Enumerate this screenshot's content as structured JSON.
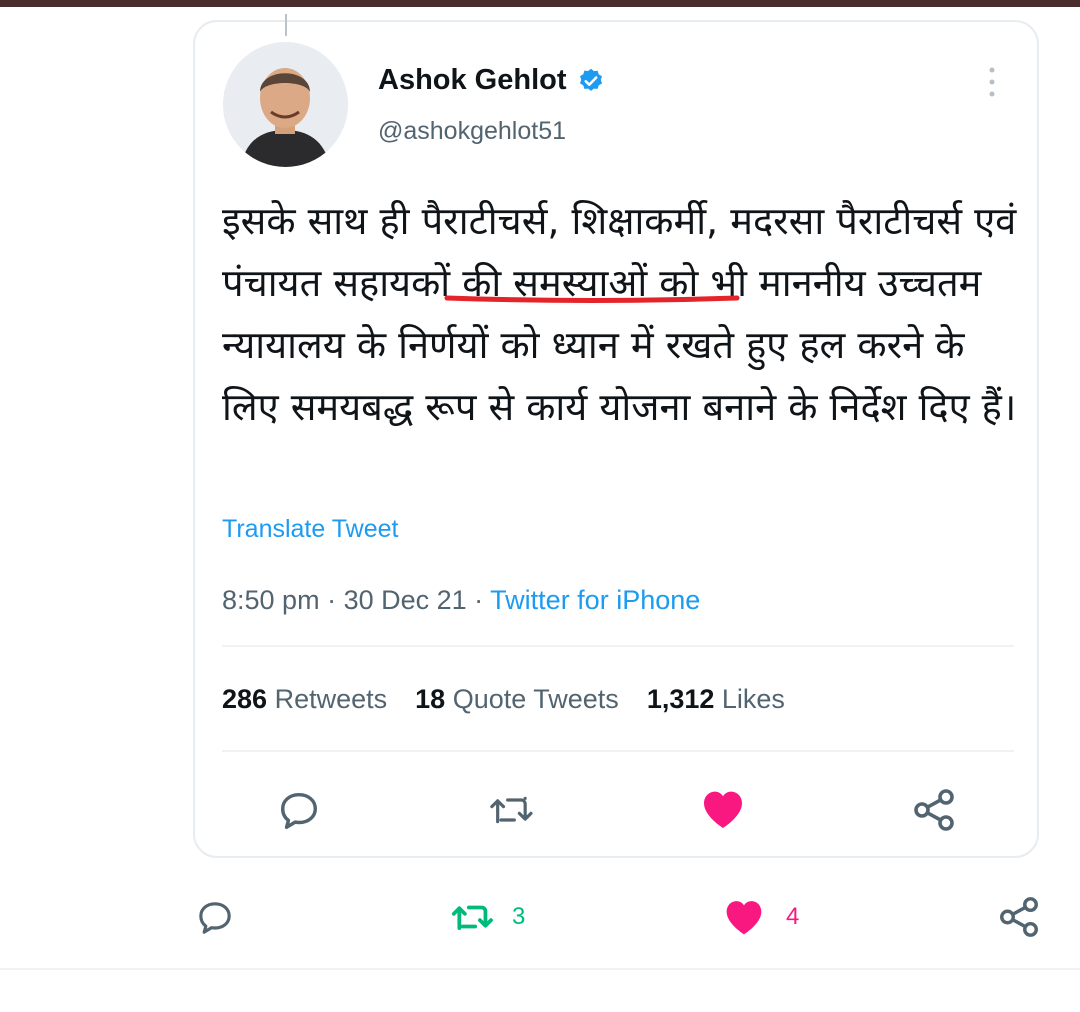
{
  "tweet": {
    "author_name": "Ashok Gehlot",
    "handle": "@ashokgehlot51",
    "verified": true,
    "text": "इसके साथ ही पैराटीचर्स, शिक्षाकर्मी, मदरसा पैराटीचर्स एवं पंचायत सहायकों की समस्याओं को भी माननीय उच्चतम न्यायालय के निर्णयों को ध्यान में रखते हुए हल करने के लिए समयबद्ध रूप से कार्य योजना बनाने के निर्देश दिए हैं।",
    "underlined_phrase": "पंचायत सहायकों",
    "translate_label": "Translate Tweet",
    "time": "8:50 pm",
    "date": "30 Dec 21",
    "source": "Twitter for iPhone",
    "retweets": "286",
    "retweets_label": "Retweets",
    "quote_tweets": "18",
    "quote_tweets_label": "Quote Tweets",
    "likes": "1,312",
    "likes_label": "Likes",
    "liked": true
  },
  "share_post": {
    "retweet_count": "3",
    "like_count": "4"
  },
  "colors": {
    "accent": "#1d9bf0",
    "like": "#f91880",
    "retweet_active": "#00ba7c",
    "muted_text": "#536471",
    "underline": "#e3242b"
  },
  "icons": [
    "more-icon",
    "verified-badge-icon",
    "reply-icon",
    "retweet-icon",
    "heart-icon",
    "share-icon"
  ]
}
